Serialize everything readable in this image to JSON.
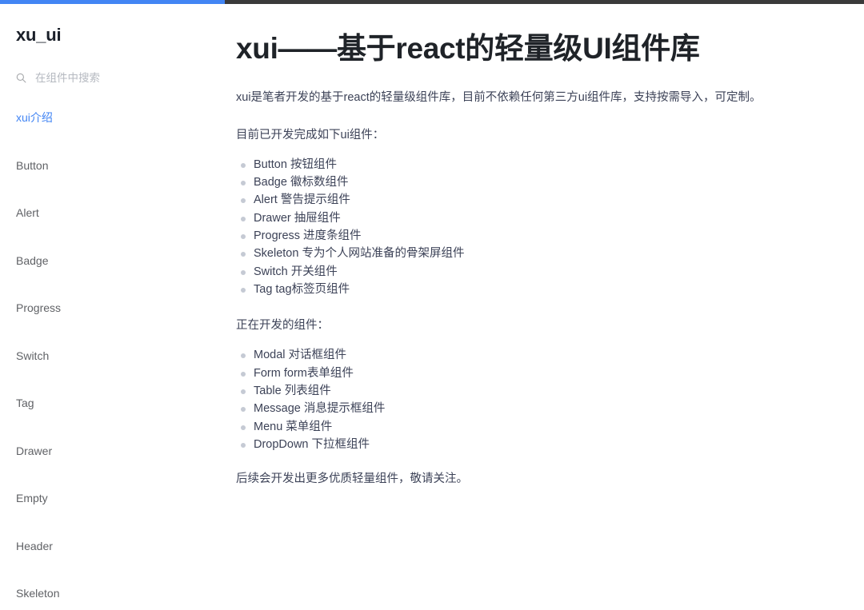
{
  "theme": {
    "accent": "#4285f4",
    "progress_track": "#3a3a3a",
    "body_text": "#3c4257",
    "bullet": "#c5cad4",
    "nav_text": "#606266",
    "brand_text": "#1a1f29"
  },
  "progress": {
    "value": 26,
    "label": "26%"
  },
  "sidebar": {
    "brand": "xu_ui",
    "search": {
      "placeholder": "在组件中搜索",
      "value": "",
      "icon": "search-icon"
    },
    "items": [
      {
        "label": "xui介绍",
        "active": true
      },
      {
        "label": "Button",
        "active": false
      },
      {
        "label": "Alert",
        "active": false
      },
      {
        "label": "Badge",
        "active": false
      },
      {
        "label": "Progress",
        "active": false
      },
      {
        "label": "Switch",
        "active": false
      },
      {
        "label": "Tag",
        "active": false
      },
      {
        "label": "Drawer",
        "active": false
      },
      {
        "label": "Empty",
        "active": false
      },
      {
        "label": "Header",
        "active": false
      },
      {
        "label": "Skeleton",
        "active": false
      }
    ]
  },
  "main": {
    "title": "xui——基于react的轻量级UI组件库",
    "intro": "xui是笔者开发的基于react的轻量级组件库，目前不依赖任何第三方ui组件库，支持按需导入，可定制。",
    "done_heading": "目前已开发完成如下ui组件：",
    "done_items": [
      "Button 按钮组件",
      "Badge 徽标数组件",
      "Alert 警告提示组件",
      "Drawer 抽屉组件",
      "Progress 进度条组件",
      "Skeleton 专为个人网站准备的骨架屏组件",
      "Switch 开关组件",
      "Tag tag标签页组件"
    ],
    "wip_heading": "正在开发的组件：",
    "wip_items": [
      "Modal 对话框组件",
      "Form form表单组件",
      "Table 列表组件",
      "Message 消息提示框组件",
      "Menu 菜单组件",
      "DropDown 下拉框组件"
    ],
    "outro": "后续会开发出更多优质轻量组件，敬请关注。"
  }
}
